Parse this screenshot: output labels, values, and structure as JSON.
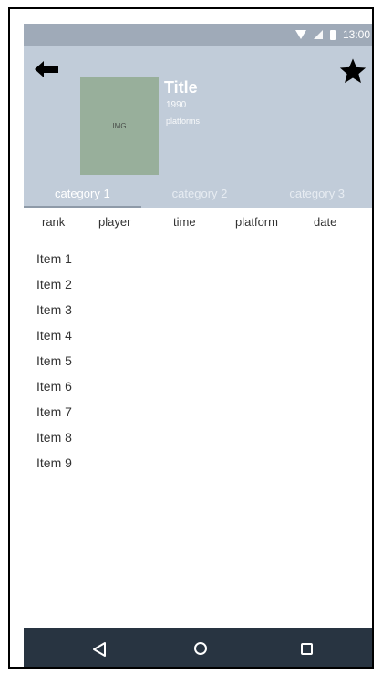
{
  "status_bar": {
    "time": "13:00"
  },
  "header": {
    "image_label": "IMG",
    "title": "Title",
    "year": "1990",
    "platforms": "platforms"
  },
  "tabs": [
    {
      "label": "category 1",
      "active": true
    },
    {
      "label": "category 2",
      "active": false
    },
    {
      "label": "category 3",
      "active": false
    }
  ],
  "table": {
    "columns": [
      "rank",
      "player",
      "time",
      "platform",
      "date"
    ],
    "items": [
      "Item 1",
      "Item 2",
      "Item 3",
      "Item 4",
      "Item 5",
      "Item 6",
      "Item 7",
      "Item 8",
      "Item 9"
    ]
  },
  "icons": {
    "back": "back-arrow-icon",
    "favorite": "star-icon",
    "nav_back": "triangle-back-icon",
    "nav_home": "circle-home-icon",
    "nav_recent": "square-recent-icon"
  },
  "colors": {
    "status_bar": "#9faab8",
    "header": "#c1ccd9",
    "nav_bar": "#283441",
    "image_placeholder": "#98af9b"
  }
}
